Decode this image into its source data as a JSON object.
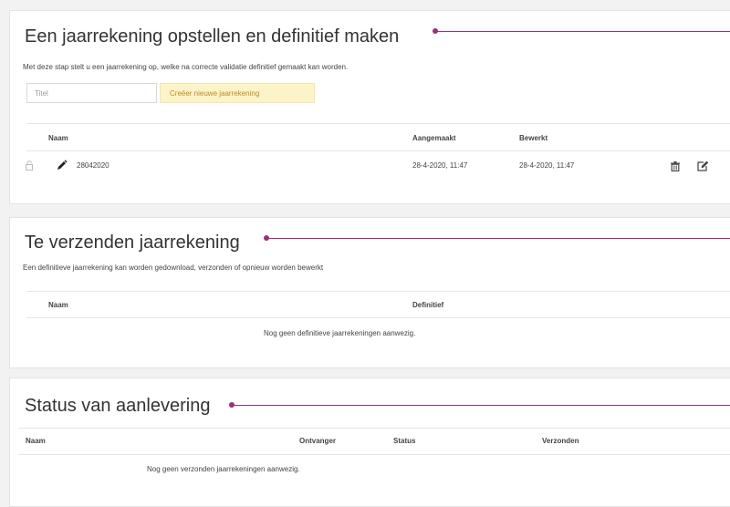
{
  "section1": {
    "title": "Een jaarrekening opstellen en definitief maken",
    "description": "Met deze stap stelt u een jaarrekening op, welke na correcte validatie definitief gemaakt kan worden.",
    "input_placeholder": "Titel",
    "create_button": "Creëer nieuwe jaarrekening",
    "columns": {
      "name": "Naam",
      "created": "Aangemaakt",
      "edited": "Bewerkt"
    },
    "rows": [
      {
        "name": "28042020",
        "created": "28-4-2020, 11:47",
        "edited": "28-4-2020, 11:47",
        "icons": [
          "lock-icon",
          "pencil-icon",
          "trash-icon",
          "edit-icon"
        ]
      }
    ]
  },
  "section2": {
    "title": "Te verzenden jaarrekening",
    "description": "Een definitieve jaarrekening kan worden gedownload, verzonden of opnieuw worden bewerkt",
    "columns": {
      "name": "Naam",
      "final": "Definitief"
    },
    "empty_text": "Nog geen definitieve jaarrekeningen aanwezig."
  },
  "section3": {
    "title": "Status van aanlevering",
    "columns": {
      "name": "Naam",
      "receiver": "Ontvanger",
      "status": "Status",
      "sent": "Verzonden"
    },
    "empty_text": "Nog geen verzonden jaarrekeningen aanwezig."
  },
  "colors": {
    "annotation": "#9c2f78",
    "button_bg": "#fdf3c9",
    "button_text": "#b98b27"
  }
}
